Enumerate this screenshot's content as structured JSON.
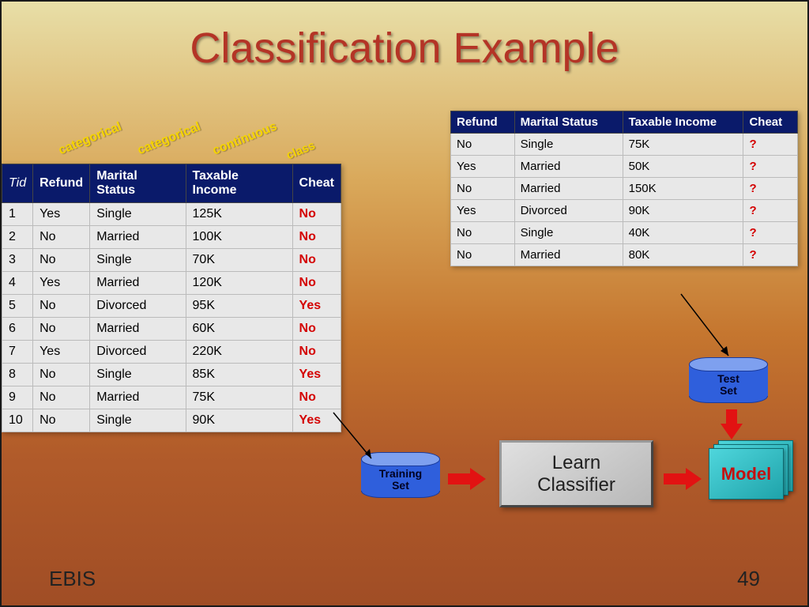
{
  "title": "Classification Example",
  "annotations": {
    "c1": "categorical",
    "c2": "categorical",
    "c3": "continuous",
    "c4": "class"
  },
  "training": {
    "headers": {
      "tid": "Tid",
      "refund": "Refund",
      "marital": "Marital Status",
      "income": "Taxable Income",
      "cheat": "Cheat"
    },
    "rows": [
      {
        "tid": "1",
        "refund": "Yes",
        "marital": "Single",
        "income": "125K",
        "cheat": "No"
      },
      {
        "tid": "2",
        "refund": "No",
        "marital": "Married",
        "income": "100K",
        "cheat": "No"
      },
      {
        "tid": "3",
        "refund": "No",
        "marital": "Single",
        "income": "70K",
        "cheat": "No"
      },
      {
        "tid": "4",
        "refund": "Yes",
        "marital": "Married",
        "income": "120K",
        "cheat": "No"
      },
      {
        "tid": "5",
        "refund": "No",
        "marital": "Divorced",
        "income": "95K",
        "cheat": "Yes"
      },
      {
        "tid": "6",
        "refund": "No",
        "marital": "Married",
        "income": "60K",
        "cheat": "No"
      },
      {
        "tid": "7",
        "refund": "Yes",
        "marital": "Divorced",
        "income": "220K",
        "cheat": "No"
      },
      {
        "tid": "8",
        "refund": "No",
        "marital": "Single",
        "income": "85K",
        "cheat": "Yes"
      },
      {
        "tid": "9",
        "refund": "No",
        "marital": "Married",
        "income": "75K",
        "cheat": "No"
      },
      {
        "tid": "10",
        "refund": "No",
        "marital": "Single",
        "income": "90K",
        "cheat": "Yes"
      }
    ]
  },
  "test": {
    "headers": {
      "refund": "Refund",
      "marital": "Marital Status",
      "income": "Taxable Income",
      "cheat": "Cheat"
    },
    "rows": [
      {
        "refund": "No",
        "marital": "Single",
        "income": "75K",
        "cheat": "?"
      },
      {
        "refund": "Yes",
        "marital": "Married",
        "income": "50K",
        "cheat": "?"
      },
      {
        "refund": "No",
        "marital": "Married",
        "income": "150K",
        "cheat": "?"
      },
      {
        "refund": "Yes",
        "marital": "Divorced",
        "income": "90K",
        "cheat": "?"
      },
      {
        "refund": "No",
        "marital": "Single",
        "income": "40K",
        "cheat": "?"
      },
      {
        "refund": "No",
        "marital": "Married",
        "income": "80K",
        "cheat": "?"
      }
    ]
  },
  "labels": {
    "training_set": "Training\nSet",
    "test_set": "Test\nSet",
    "learn": "Learn\nClassifier",
    "model": "Model"
  },
  "footer": {
    "left": "EBIS",
    "right": "49"
  },
  "chart_data": {
    "type": "table",
    "description": "Training set of 10 records (Tid, Refund, Marital Status, Taxable Income, Cheat class label) and test set of 6 unlabeled records. Flow: Training Set → Learn Classifier → Model; Test Set → Model.",
    "training_rows": [
      [
        1,
        "Yes",
        "Single",
        "125K",
        "No"
      ],
      [
        2,
        "No",
        "Married",
        "100K",
        "No"
      ],
      [
        3,
        "No",
        "Single",
        "70K",
        "No"
      ],
      [
        4,
        "Yes",
        "Married",
        "120K",
        "No"
      ],
      [
        5,
        "No",
        "Divorced",
        "95K",
        "Yes"
      ],
      [
        6,
        "No",
        "Married",
        "60K",
        "No"
      ],
      [
        7,
        "Yes",
        "Divorced",
        "220K",
        "No"
      ],
      [
        8,
        "No",
        "Single",
        "85K",
        "Yes"
      ],
      [
        9,
        "No",
        "Married",
        "75K",
        "No"
      ],
      [
        10,
        "No",
        "Single",
        "90K",
        "Yes"
      ]
    ],
    "test_rows": [
      [
        "No",
        "Single",
        "75K",
        "?"
      ],
      [
        "Yes",
        "Married",
        "50K",
        "?"
      ],
      [
        "No",
        "Married",
        "150K",
        "?"
      ],
      [
        "Yes",
        "Divorced",
        "90K",
        "?"
      ],
      [
        "No",
        "Single",
        "40K",
        "?"
      ],
      [
        "No",
        "Married",
        "80K",
        "?"
      ]
    ]
  }
}
